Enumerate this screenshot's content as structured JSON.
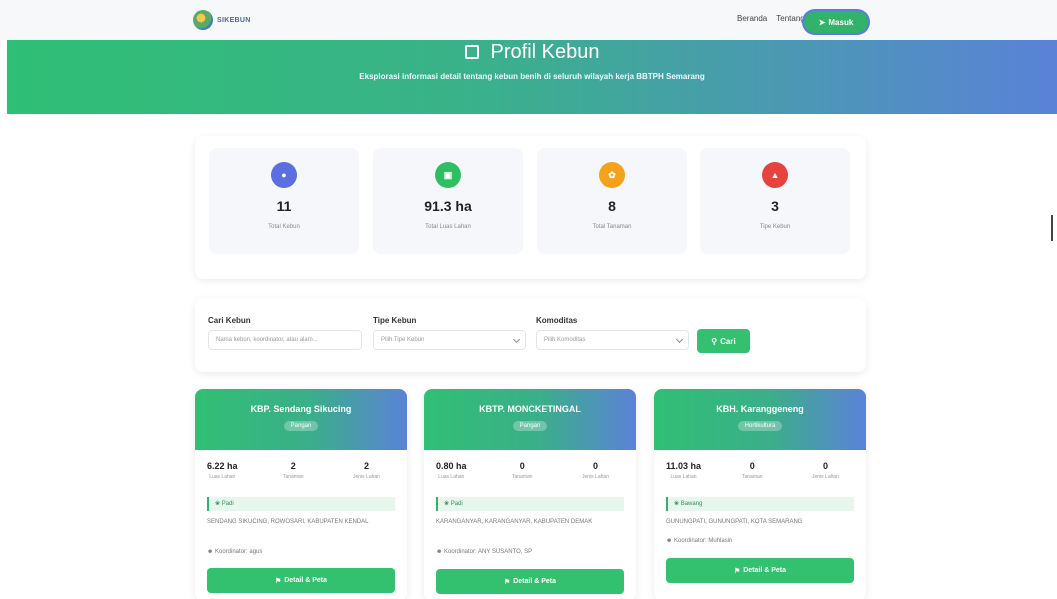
{
  "navbar": {
    "logo_text": "SIKEBUN",
    "links": [
      "Beranda",
      "Tentang"
    ],
    "login_label": "Masuk",
    "login_icon": "login-icon"
  },
  "hero": {
    "title": "Profil Kebun",
    "title_icon": "garden-map-icon",
    "subtitle": "Eksplorasi informasi detail tentang kebun benih di seluruh wilayah kerja BBTPH Semarang"
  },
  "stats": [
    {
      "icon": "garden-icon",
      "color": "#5b6fe0",
      "value": "11",
      "label": "Total Kebun"
    },
    {
      "icon": "area-icon",
      "color": "#2fbf63",
      "value": "91.3 ha",
      "label": "Total Luas Lahan"
    },
    {
      "icon": "plant-icon",
      "color": "#f5a21b",
      "value": "8",
      "label": "Total Tanaman"
    },
    {
      "icon": "type-icon",
      "color": "#e8423f",
      "value": "3",
      "label": "Tipe Kebun"
    }
  ],
  "filters": {
    "search": {
      "label": "Cari Kebun",
      "placeholder": "Nama kebun, koordinator, atau alam..."
    },
    "type": {
      "label": "Tipe Kebun",
      "placeholder": "Pilih Tipe Kebun"
    },
    "commodity": {
      "label": "Komoditas",
      "placeholder": "Pilih Komoditas"
    },
    "search_button": "Cari"
  },
  "gardens": [
    {
      "name": "KBP. Sendang Sikucing",
      "type": "Pangan",
      "stats": [
        {
          "value": "6.22 ha",
          "label": "Luas Lahan"
        },
        {
          "value": "2",
          "label": "Tanaman"
        },
        {
          "value": "2",
          "label": "Jenis Lahan"
        }
      ],
      "commodity": "Padi",
      "location": "SENDANG SIKUCING, ROWOSARI, KABUPATEN KENDAL",
      "coordinator": "Koordinator: agus",
      "button": "Detail & Peta"
    },
    {
      "name": "KBTP. MONCKETINGAL",
      "type": "Pangan",
      "stats": [
        {
          "value": "0.80 ha",
          "label": "Luas Lahan"
        },
        {
          "value": "0",
          "label": "Tanaman"
        },
        {
          "value": "0",
          "label": "Jenis Lahan"
        }
      ],
      "commodity": "Padi",
      "location": "KARANGANYAR, KARANGANYAR, KABUPATEN DEMAK",
      "coordinator": "Koordinator: ANY SUSANTO, SP",
      "button": "Detail & Peta"
    },
    {
      "name": "KBH. Karanggeneng",
      "type": "Hortikultura",
      "stats": [
        {
          "value": "11.03 ha",
          "label": "Luas Lahan"
        },
        {
          "value": "0",
          "label": "Tanaman"
        },
        {
          "value": "0",
          "label": "Jenis Lahan"
        }
      ],
      "commodity": "Bawang",
      "location": "GUNUNGPATI, GUNUNGPATI, KOTA SEMARANG",
      "coordinator": "Koordinator: Muhlasin",
      "button": "Detail & Peta"
    }
  ]
}
